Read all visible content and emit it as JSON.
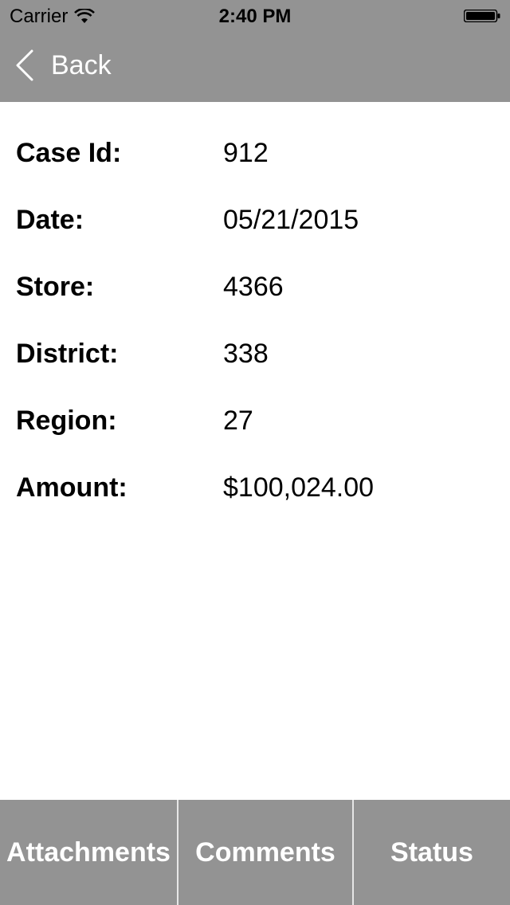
{
  "status_bar": {
    "carrier": "Carrier",
    "time": "2:40 PM"
  },
  "nav": {
    "back_label": "Back"
  },
  "details": [
    {
      "label": "Case Id:",
      "value": "912"
    },
    {
      "label": "Date:",
      "value": "05/21/2015"
    },
    {
      "label": "Store:",
      "value": "4366"
    },
    {
      "label": "District:",
      "value": "338"
    },
    {
      "label": "Region:",
      "value": "27"
    },
    {
      "label": "Amount:",
      "value": "$100,024.00"
    }
  ],
  "tabs": [
    {
      "label": "Attachments"
    },
    {
      "label": "Comments"
    },
    {
      "label": "Status"
    }
  ],
  "colors": {
    "bar_background": "#939393",
    "bar_text": "#ffffff",
    "content_background": "#ffffff"
  },
  "icons": {
    "wifi": "wifi-icon",
    "battery": "battery-icon",
    "back": "chevron-left-icon"
  }
}
